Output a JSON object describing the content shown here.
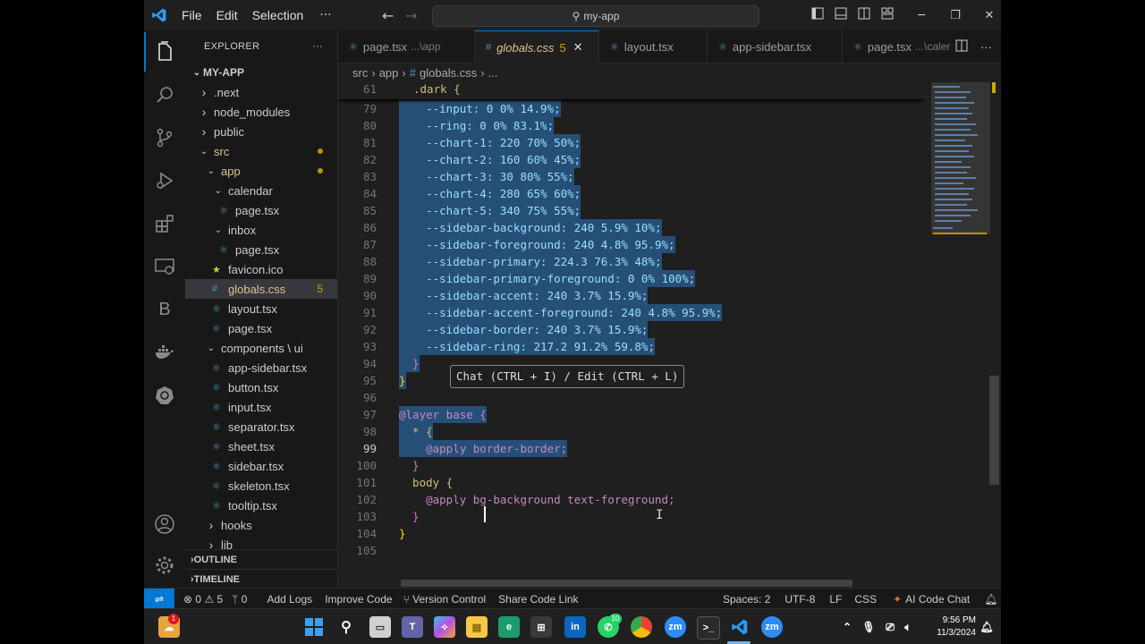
{
  "titlebar": {
    "menus": [
      "File",
      "Edit",
      "Selection"
    ],
    "more": "···",
    "command_center": "my-app"
  },
  "sidebar": {
    "title": "EXPLORER",
    "more": "···",
    "root": "MY-APP",
    "items": [
      {
        "label": ".next",
        "kind": "folder-closed",
        "depth": 1
      },
      {
        "label": "node_modules",
        "kind": "folder-closed",
        "depth": 1
      },
      {
        "label": "public",
        "kind": "folder-closed",
        "depth": 1
      },
      {
        "label": "src",
        "kind": "folder-open",
        "depth": 1,
        "dot": true
      },
      {
        "label": "app",
        "kind": "folder-open",
        "depth": 2,
        "dot": true
      },
      {
        "label": "calendar",
        "kind": "folder-open",
        "depth": 3
      },
      {
        "label": "page.tsx",
        "kind": "tsx",
        "depth": 4
      },
      {
        "label": "inbox",
        "kind": "folder-open",
        "depth": 3
      },
      {
        "label": "page.tsx",
        "kind": "tsx",
        "depth": 4
      },
      {
        "label": "favicon.ico",
        "kind": "star",
        "depth": 3
      },
      {
        "label": "globals.css",
        "kind": "css",
        "depth": 3,
        "badge": "5",
        "selected": true
      },
      {
        "label": "layout.tsx",
        "kind": "tsx",
        "depth": 3
      },
      {
        "label": "page.tsx",
        "kind": "tsx",
        "depth": 3
      },
      {
        "label": "components \\ ui",
        "kind": "folder-open",
        "depth": 2
      },
      {
        "label": "app-sidebar.tsx",
        "kind": "tsx",
        "depth": 3
      },
      {
        "label": "button.tsx",
        "kind": "tsx",
        "depth": 3
      },
      {
        "label": "input.tsx",
        "kind": "tsx",
        "depth": 3
      },
      {
        "label": "separator.tsx",
        "kind": "tsx",
        "depth": 3
      },
      {
        "label": "sheet.tsx",
        "kind": "tsx",
        "depth": 3
      },
      {
        "label": "sidebar.tsx",
        "kind": "tsx",
        "depth": 3
      },
      {
        "label": "skeleton.tsx",
        "kind": "tsx",
        "depth": 3
      },
      {
        "label": "tooltip.tsx",
        "kind": "tsx",
        "depth": 3
      },
      {
        "label": "hooks",
        "kind": "folder-closed",
        "depth": 2
      },
      {
        "label": "lib",
        "kind": "folder-closed",
        "depth": 2
      }
    ],
    "sections": [
      "OUTLINE",
      "TIMELINE"
    ]
  },
  "tabs": [
    {
      "label": "page.tsx",
      "desc": "...\\app",
      "active": false
    },
    {
      "label": "globals.css",
      "desc": "",
      "modified": "5",
      "active": true
    },
    {
      "label": "layout.tsx",
      "desc": "",
      "active": false
    },
    {
      "label": "app-sidebar.tsx",
      "desc": "",
      "active": false
    },
    {
      "label": "page.tsx",
      "desc": "...\\calend",
      "active": false
    }
  ],
  "breadcrumb": [
    "src",
    "app",
    "globals.css",
    "..."
  ],
  "editor": {
    "sticky": {
      "num": "61",
      "text": ".dark {"
    },
    "lines": [
      {
        "num": "79",
        "text": "    --input: 0 0% 14.9%;"
      },
      {
        "num": "80",
        "text": "    --ring: 0 0% 83.1%;"
      },
      {
        "num": "81",
        "text": "    --chart-1: 220 70% 50%;"
      },
      {
        "num": "82",
        "text": "    --chart-2: 160 60% 45%;"
      },
      {
        "num": "83",
        "text": "    --chart-3: 30 80% 55%;"
      },
      {
        "num": "84",
        "text": "    --chart-4: 280 65% 60%;"
      },
      {
        "num": "85",
        "text": "    --chart-5: 340 75% 55%;"
      },
      {
        "num": "86",
        "text": "    --sidebar-background: 240 5.9% 10%;"
      },
      {
        "num": "87",
        "text": "    --sidebar-foreground: 240 4.8% 95.9%;"
      },
      {
        "num": "88",
        "text": "    --sidebar-primary: 224.3 76.3% 48%;"
      },
      {
        "num": "89",
        "text": "    --sidebar-primary-foreground: 0 0% 100%;"
      },
      {
        "num": "90",
        "text": "    --sidebar-accent: 240 3.7% 15.9%;"
      },
      {
        "num": "91",
        "text": "    --sidebar-accent-foreground: 240 4.8% 95.9%;"
      },
      {
        "num": "92",
        "text": "    --sidebar-border: 240 3.7% 15.9%;"
      },
      {
        "num": "93",
        "text": "    --sidebar-ring: 217.2 91.2% 59.8%;"
      },
      {
        "num": "94",
        "text": "  }"
      },
      {
        "num": "95",
        "text": "}"
      },
      {
        "num": "96",
        "text": ""
      },
      {
        "num": "97",
        "text": "@layer base {"
      },
      {
        "num": "98",
        "text": "  * {"
      },
      {
        "num": "99",
        "text": "    @apply border-border;"
      },
      {
        "num": "100",
        "text": "  }"
      },
      {
        "num": "101",
        "text": "  body {"
      },
      {
        "num": "102",
        "text": "    @apply bg-background text-foreground;"
      },
      {
        "num": "103",
        "text": "  }"
      },
      {
        "num": "104",
        "text": "}"
      },
      {
        "num": "105",
        "text": ""
      }
    ],
    "current_line": "99",
    "inline_hint": "Chat (CTRL + I) / Edit (CTRL + L)"
  },
  "statusbar": {
    "errors": "0",
    "warnings": "5",
    "ports": "0",
    "items_left": [
      "Add Logs",
      "Improve Code",
      "Version Control",
      "Share Code Link"
    ],
    "spaces": "Spaces: 2",
    "encoding": "UTF-8",
    "eol": "LF",
    "language": "CSS",
    "ai": "AI Code Chat"
  },
  "taskbar": {
    "time": "9:56 PM",
    "date": "11/3/2024",
    "notification_badge": "1",
    "whatsapp_badge": "10"
  },
  "colors": {
    "accent": "#0078d4",
    "selection": "#264f78",
    "modified": "#cca700"
  }
}
